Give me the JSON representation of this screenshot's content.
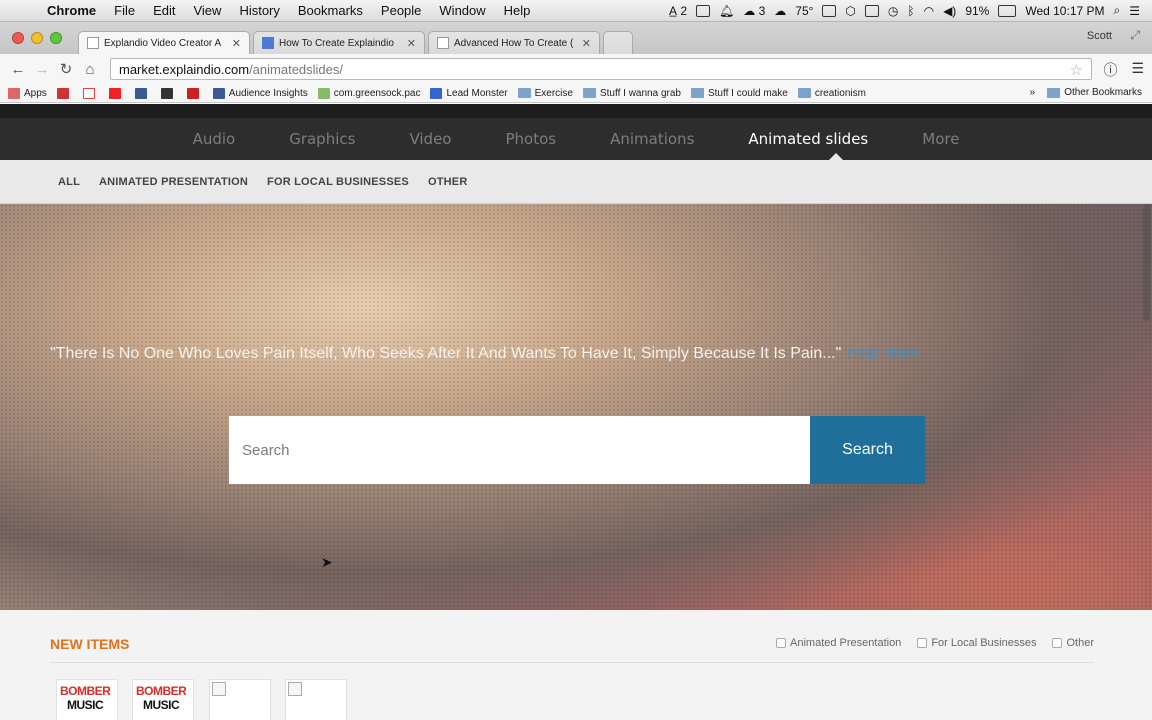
{
  "menubar": {
    "items": [
      "Chrome",
      "File",
      "Edit",
      "View",
      "History",
      "Bookmarks",
      "People",
      "Window",
      "Help"
    ],
    "battery": "91%",
    "clock": "Wed 10:17 PM",
    "weather": "75°"
  },
  "tabs": [
    {
      "title": "Explandio Video Creator A",
      "active": true
    },
    {
      "title": "How To Create Explaindio",
      "active": false
    },
    {
      "title": "Advanced How To Create (",
      "active": false
    }
  ],
  "profile": "Scott",
  "omnibox": {
    "host": "market.explaindio.com",
    "path": "/animatedslides/"
  },
  "bookmarks": [
    {
      "label": "Apps",
      "color": "#d66"
    },
    {
      "label": "",
      "color": "#c33"
    },
    {
      "label": "",
      "color": "#d44"
    },
    {
      "label": "",
      "color": "#e22"
    },
    {
      "label": "",
      "color": "#3b5998"
    },
    {
      "label": "",
      "color": "#333"
    },
    {
      "label": "",
      "color": "#c22"
    },
    {
      "label": "Audience Insights",
      "color": "#3b5998"
    },
    {
      "label": "com.greensock.pac",
      "color": "#8b6"
    },
    {
      "label": "Lead Monster",
      "color": "#36c"
    },
    {
      "label": "Exercise",
      "folder": true
    },
    {
      "label": "Stuff I wanna grab",
      "folder": true
    },
    {
      "label": "Stuff I could make",
      "folder": true
    },
    {
      "label": "creationism",
      "folder": true
    }
  ],
  "other_bookmarks": "Other Bookmarks",
  "categories": [
    {
      "label": "Audio",
      "active": false
    },
    {
      "label": "Graphics",
      "active": false
    },
    {
      "label": "Video",
      "active": false
    },
    {
      "label": "Photos",
      "active": false
    },
    {
      "label": "Animations",
      "active": false
    },
    {
      "label": "Animated slides",
      "active": true
    },
    {
      "label": "More",
      "active": false
    }
  ],
  "subnav": [
    "ALL",
    "ANIMATED PRESENTATION",
    "FOR LOCAL BUSINESSES",
    "OTHER"
  ],
  "hero": {
    "quote": "\"There Is No One Who Loves Pain Itself, Who Seeks After It And Wants To Have It, Simply Because It Is Pain...\"",
    "read_more": "read more",
    "search_placeholder": "Search",
    "search_button": "Search"
  },
  "new_items": {
    "title": "NEW ITEMS",
    "filters": [
      "Animated Presentation",
      "For Local Businesses",
      "Other"
    ],
    "thumbs": [
      {
        "line1": "BOMBER",
        "line2": "MUSIC"
      },
      {
        "line1": "BOMBER",
        "line2": "MUSIC"
      },
      {
        "line1": "",
        "line2": ""
      },
      {
        "line1": "",
        "line2": ""
      }
    ]
  }
}
